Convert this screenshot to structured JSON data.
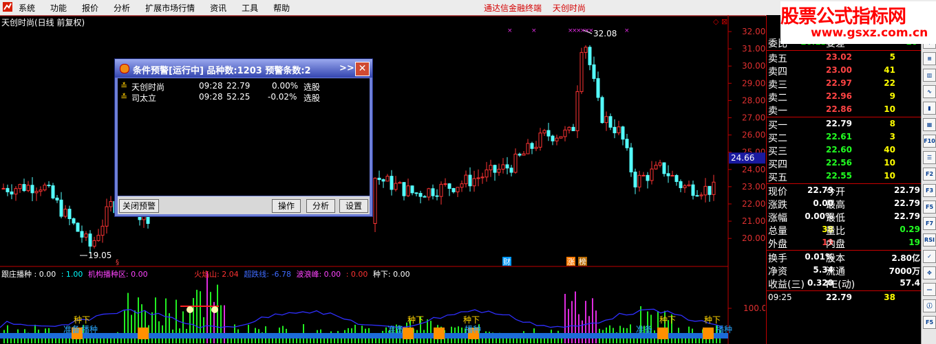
{
  "menu": {
    "items": [
      "系统",
      "功能",
      "报价",
      "分析",
      "扩展市场行情",
      "资讯",
      "工具",
      "帮助"
    ],
    "app_title": [
      "通达信金融终端",
      "天创时尚"
    ]
  },
  "watermark": {
    "line1": "股票公式指标网",
    "line2": "www.gsxz.com.cn"
  },
  "chart": {
    "label": "天创时尚(日线 前复权)",
    "price_ticks": [
      "32.00",
      "31.00",
      "30.00",
      "29.00",
      "28.00",
      "27.00",
      "26.00",
      "25.00",
      "24.00",
      "23.00",
      "22.00",
      "21.00",
      "20.00"
    ],
    "current_price_tag": "24.66",
    "high_label": "32.08",
    "low_label": "19.05",
    "volume_axis_label": "100.0",
    "markers": [
      "财",
      "涨",
      "榜"
    ],
    "zhongxia": [
      "种下",
      "种下",
      "种下",
      "种下",
      "种下"
    ],
    "zhunbei": [
      "准备",
      "准备",
      "准备"
    ],
    "bozhong": [
      "播种",
      "播种",
      "播种"
    ]
  },
  "indicator_legend": [
    {
      "text": "跟庄播种 : 0.00",
      "color": "#ffffff"
    },
    {
      "text": ": 1.00",
      "color": "#00ffff"
    },
    {
      "text": "机构播种区: 0.00",
      "color": "#ff44ff"
    },
    {
      "text": "火焰山: 2.04",
      "color": "#ff3333"
    },
    {
      "text": "超跌线: -6.78",
      "color": "#3f6bff"
    },
    {
      "text": "波浪峰: 0.00",
      "color": "#ff44ff"
    },
    {
      "text": ": 0.00",
      "color": "#ff3333"
    },
    {
      "text": "种下: 0.00",
      "color": "#ffffff"
    }
  ],
  "dialog": {
    "title": "条件预警[运行中] 品种数:1203 预警条数:2",
    "more": ">>",
    "close": "✕",
    "alerts": [
      {
        "name": "天创时尚",
        "time": "09:28",
        "price": "22.79",
        "change": "0.00%",
        "action": "选股"
      },
      {
        "name": "司太立",
        "time": "09:28",
        "price": "52.25",
        "change": "-0.02%",
        "action": "选股"
      }
    ],
    "buttons": {
      "close_alert": "关闭预警",
      "operate": "操作",
      "analyze": "分析",
      "settings": "设置"
    }
  },
  "quote": {
    "wei": {
      "label": "委比",
      "value": "-16.13%",
      "label2": "委差",
      "value2": "-10"
    },
    "sell": [
      {
        "label": "卖五",
        "price": "23.02",
        "vol": "5"
      },
      {
        "label": "卖四",
        "price": "23.00",
        "vol": "41"
      },
      {
        "label": "卖三",
        "price": "22.97",
        "vol": "22"
      },
      {
        "label": "卖二",
        "price": "22.96",
        "vol": "9"
      },
      {
        "label": "卖一",
        "price": "22.86",
        "vol": "10"
      }
    ],
    "buy": [
      {
        "label": "买一",
        "price": "22.79",
        "vol": "8"
      },
      {
        "label": "买二",
        "price": "22.61",
        "vol": "3"
      },
      {
        "label": "买三",
        "price": "22.60",
        "vol": "40"
      },
      {
        "label": "买四",
        "price": "22.56",
        "vol": "10"
      },
      {
        "label": "买五",
        "price": "22.55",
        "vol": "10"
      }
    ],
    "stats1": [
      {
        "l": "现价",
        "v": "22.79",
        "l2": "今开",
        "v2": "22.79"
      },
      {
        "l": "涨跌",
        "v": "0.00",
        "l2": "最高",
        "v2": "22.79"
      },
      {
        "l": "涨幅",
        "v": "0.00%",
        "l2": "最低",
        "v2": "22.79"
      },
      {
        "l": "总量",
        "v": "38",
        "l2": "量比",
        "v2": "0.29"
      },
      {
        "l": "外盘",
        "v": "19",
        "l2": "内盘",
        "v2": "19"
      }
    ],
    "stats2": [
      {
        "l": "换手",
        "v": "0.01%",
        "l2": "股本",
        "v2": "2.80亿"
      },
      {
        "l": "净资",
        "v": "5.34",
        "l2": "流通",
        "v2": "7000万"
      },
      {
        "l": "收益(三)",
        "v": "0.320",
        "l2": "PE(动)",
        "v2": "57.4"
      }
    ],
    "tick": {
      "time": "09:25",
      "price": "22.79",
      "vol": "38"
    }
  },
  "toolbar": {
    "icons": [
      "up-arrow-icon",
      "down-arrow-icon",
      "list-icon",
      "bar-chart-icon",
      "line-chart-icon",
      "kline-icon",
      "table-icon",
      "f10-icon",
      "news-icon",
      "f2-icon",
      "f3-icon",
      "f5-icon",
      "f7-icon",
      "rsi-icon",
      "pick-icon",
      "compass-icon",
      "minus-icon",
      "info-icon",
      "f5b-icon"
    ],
    "labels": [
      "▲",
      "▼",
      "≡",
      "▥",
      "∿",
      "▮",
      "▦",
      "F10",
      "☰",
      "F2",
      "F3",
      "F5",
      "F7",
      "RSI",
      "✓",
      "✥",
      "—",
      "ⓘ",
      "F5"
    ]
  }
}
